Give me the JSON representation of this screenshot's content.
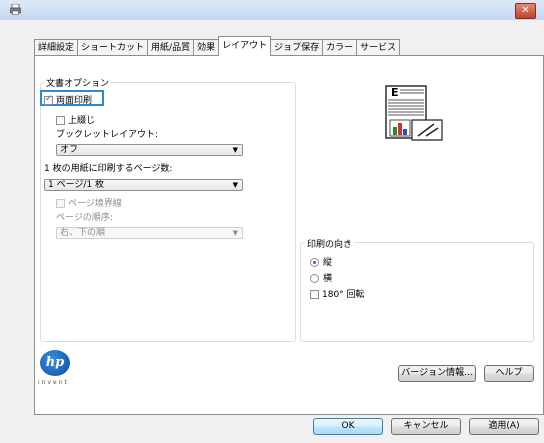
{
  "tabs": [
    "詳細設定",
    "ショートカット",
    "用紙/品質",
    "効果",
    "レイアウト",
    "ジョブ保存",
    "カラー",
    "サービス"
  ],
  "document_options": {
    "legend": "文書オプション",
    "duplex_label": "両面印刷",
    "flip_up_label": "上綴じ",
    "booklet_layout_label": "ブックレットレイアウト:",
    "booklet_layout_value": "オフ",
    "pages_per_sheet_label": "1 枚の用紙に印刷するページ数:",
    "pages_per_sheet_value": "1 ページ/1 枚",
    "print_page_borders_label": "ページ境界線",
    "page_order_label": "ページの順序:",
    "page_order_value": "右、下の順"
  },
  "orientation": {
    "legend": "印刷の向き",
    "portrait_label": "縦",
    "landscape_label": "横",
    "rotate_label": "180° 回転"
  },
  "logo": {
    "text": "hp",
    "sub": "invent"
  },
  "buttons": {
    "about": "バージョン情報...",
    "help": "ヘルプ",
    "ok": "OK",
    "cancel": "キャンセル",
    "apply": "適用(A)"
  },
  "state": {
    "duplex_checked": true,
    "flip_up_checked": false,
    "borders_checked": false,
    "orientation": "portrait",
    "rotate_checked": false,
    "active_tab": "レイアウト"
  },
  "colors": {
    "accent": "#2a8ad6",
    "close": "#c2402b",
    "panel_border": "#8e8f8f"
  }
}
